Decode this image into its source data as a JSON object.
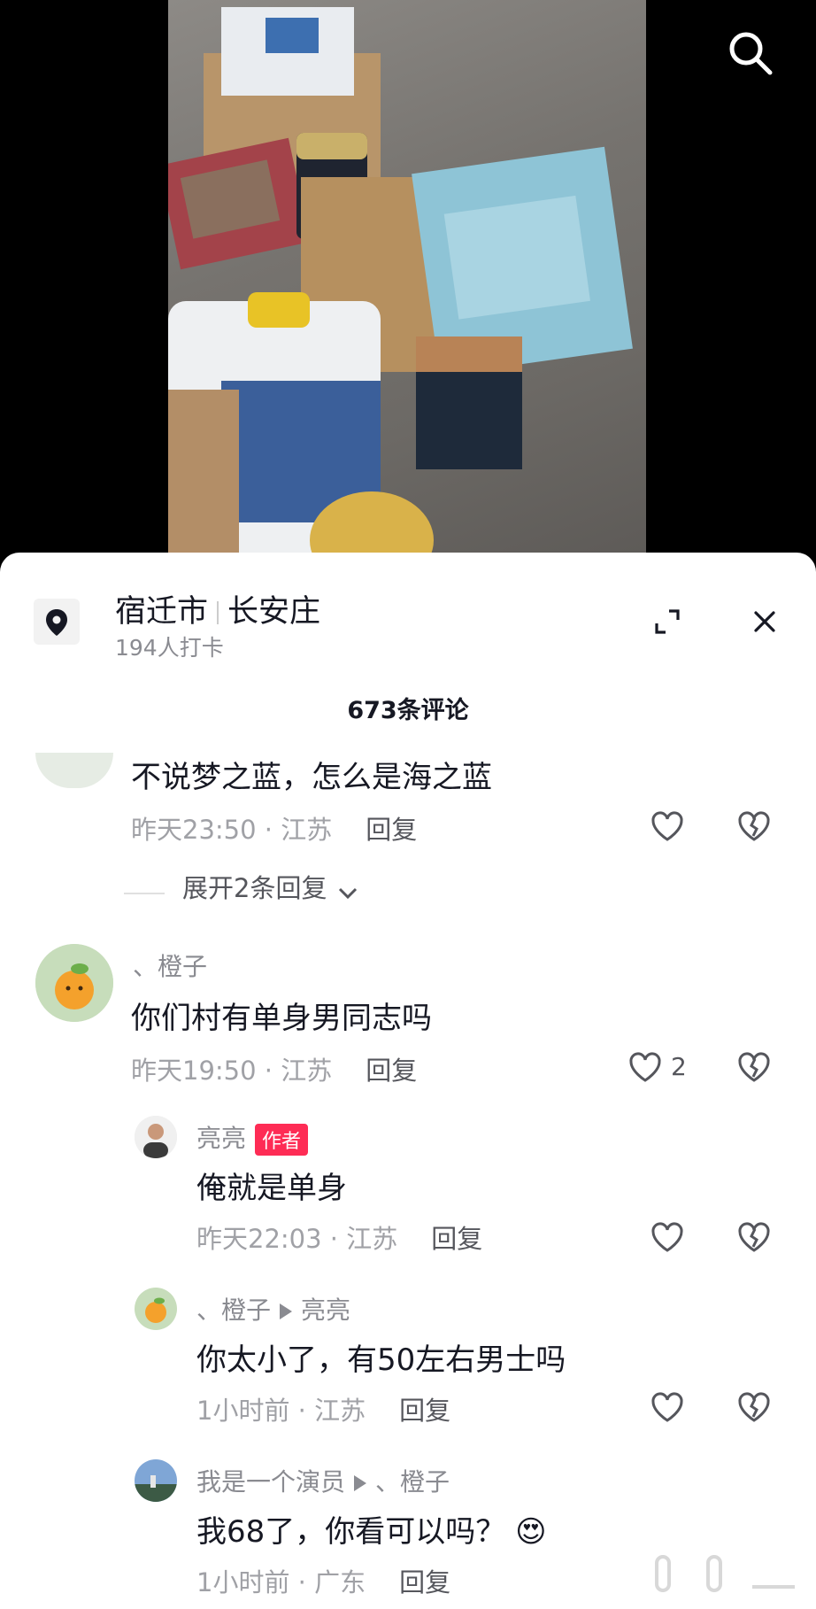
{
  "location": {
    "city": "宿迁市",
    "place": "长安庄",
    "checkins": "194人打卡"
  },
  "comments_title": "673条评论",
  "comments": {
    "c1": {
      "text": "不说梦之蓝，怎么是海之蓝",
      "time": "昨天23:50",
      "region": "江苏",
      "reply_label": "回复",
      "expand_label": "展开2条回复"
    },
    "c2": {
      "user": "、橙子",
      "text": "你们村有单身男同志吗",
      "time": "昨天19:50",
      "region": "江苏",
      "reply_label": "回复",
      "likes": "2"
    },
    "r1": {
      "user": "亮亮",
      "badge": "作者",
      "text": "俺就是单身",
      "time": "昨天22:03",
      "region": "江苏",
      "reply_label": "回复"
    },
    "r2": {
      "user": "、橙子",
      "reply_to": "亮亮",
      "text": "你太小了，有50左右男士吗",
      "time": "1小时前",
      "region": "江苏",
      "reply_label": "回复"
    },
    "r3": {
      "user": "我是一个演员",
      "reply_to": "、橙子",
      "text": "我68了，你看可以吗？",
      "emoji": "😍",
      "time": "1小时前",
      "region": "广东",
      "reply_label": "回复"
    }
  },
  "meta_separator": " · ",
  "colors": {
    "accent": "#fe2c55",
    "text_primary": "#161823",
    "text_secondary": "#8a8b91"
  },
  "icons": [
    "search-icon",
    "location-pin-icon",
    "expand-icon",
    "close-icon",
    "heart-icon",
    "broken-heart-icon",
    "chevron-down-icon"
  ]
}
